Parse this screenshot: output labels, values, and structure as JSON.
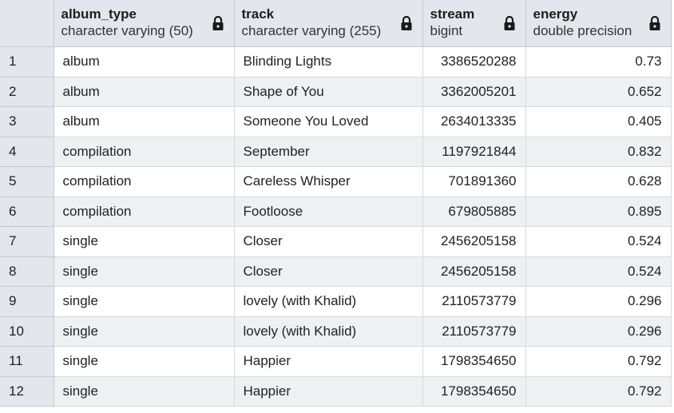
{
  "columns": [
    {
      "name": "album_type",
      "type": "character varying (50)"
    },
    {
      "name": "track",
      "type": "character varying (255)"
    },
    {
      "name": "stream",
      "type": "bigint"
    },
    {
      "name": "energy",
      "type": "double precision"
    }
  ],
  "rows": [
    {
      "n": "1",
      "album_type": "album",
      "track": "Blinding Lights",
      "stream": "3386520288",
      "energy": "0.73"
    },
    {
      "n": "2",
      "album_type": "album",
      "track": "Shape of You",
      "stream": "3362005201",
      "energy": "0.652"
    },
    {
      "n": "3",
      "album_type": "album",
      "track": "Someone You Loved",
      "stream": "2634013335",
      "energy": "0.405"
    },
    {
      "n": "4",
      "album_type": "compilation",
      "track": "September",
      "stream": "1197921844",
      "energy": "0.832"
    },
    {
      "n": "5",
      "album_type": "compilation",
      "track": "Careless Whisper",
      "stream": "701891360",
      "energy": "0.628"
    },
    {
      "n": "6",
      "album_type": "compilation",
      "track": "Footloose",
      "stream": "679805885",
      "energy": "0.895"
    },
    {
      "n": "7",
      "album_type": "single",
      "track": "Closer",
      "stream": "2456205158",
      "energy": "0.524"
    },
    {
      "n": "8",
      "album_type": "single",
      "track": "Closer",
      "stream": "2456205158",
      "energy": "0.524"
    },
    {
      "n": "9",
      "album_type": "single",
      "track": "lovely (with Khalid)",
      "stream": "2110573779",
      "energy": "0.296"
    },
    {
      "n": "10",
      "album_type": "single",
      "track": "lovely (with Khalid)",
      "stream": "2110573779",
      "energy": "0.296"
    },
    {
      "n": "11",
      "album_type": "single",
      "track": "Happier",
      "stream": "1798354650",
      "energy": "0.792"
    },
    {
      "n": "12",
      "album_type": "single",
      "track": "Happier",
      "stream": "1798354650",
      "energy": "0.792"
    }
  ],
  "icons": {
    "column_lock": "lock-icon"
  }
}
